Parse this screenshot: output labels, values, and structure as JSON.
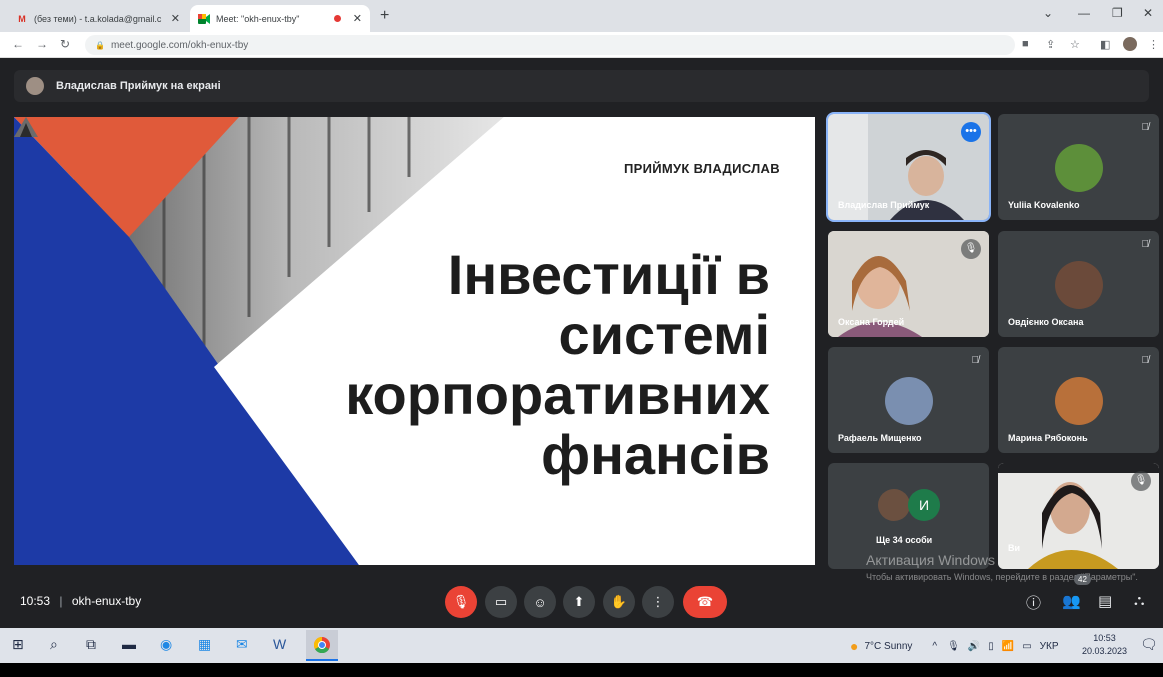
{
  "browser": {
    "tabs": [
      {
        "title": "(без теми) - t.a.kolada@gmail.c",
        "favicon": "M"
      },
      {
        "title": "Meet: \"okh-enux-tby\"",
        "favicon": "meet"
      }
    ],
    "url": "meet.google.com/okh-enux-tby"
  },
  "meet": {
    "presenter_banner": "Владислав Приймук на екрані",
    "meeting_time": "10:53",
    "meeting_code": "okh-enux-tby",
    "participants_count": "42"
  },
  "slide": {
    "author": "ПРИЙМУК ВЛАДИСЛАВ",
    "title_lines": [
      "Інвестиції в",
      "системі",
      "корпоративних",
      "фнансів"
    ]
  },
  "tiles": [
    {
      "name": "Владислав Приймук"
    },
    {
      "name": "Yuliia Kovalenko"
    },
    {
      "name": "Оксана Гордей"
    },
    {
      "name": "Овдієнко Оксана"
    },
    {
      "name": "Рафаель Мищенко"
    },
    {
      "name": "Марина Рябоконь"
    },
    {
      "name": "Ще 34 особи",
      "initial": "И"
    },
    {
      "name": "Ви"
    }
  ],
  "windows": {
    "activation_title": "Активация Windows",
    "activation_text": "Чтобы активировать Windows, перейдите в раздел \"Параметры\"."
  },
  "taskbar": {
    "weather": "7°C  Sunny",
    "lang": "УКР",
    "time": "10:53",
    "date": "20.03.2023"
  },
  "colors": {
    "meet_bg": "#202124",
    "slide_blue": "#1d3aa6",
    "slide_orange": "#e05a3a",
    "end_call_red": "#ea4335"
  }
}
